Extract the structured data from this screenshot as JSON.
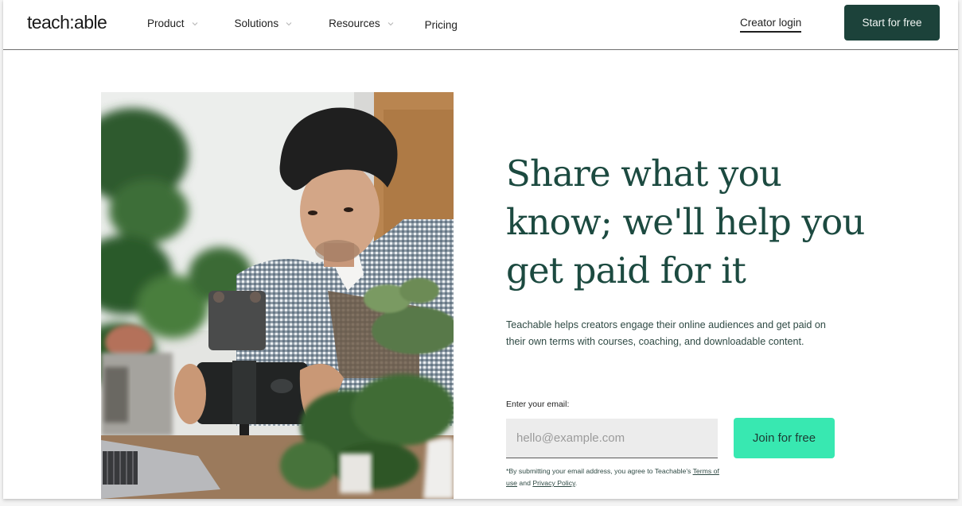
{
  "header": {
    "logo": "teach:able",
    "nav": [
      {
        "label": "Product",
        "has_dropdown": true
      },
      {
        "label": "Solutions",
        "has_dropdown": true
      },
      {
        "label": "Resources",
        "has_dropdown": true
      },
      {
        "label": "Pricing",
        "has_dropdown": false
      }
    ],
    "creator_login": "Creator login",
    "start_button": "Start for free"
  },
  "hero": {
    "photo_alt": "Man filming plants with a smartphone on a tripod",
    "headline": "Share what you know; we'll help you get paid for it",
    "subtext": "Teachable helps creators engage their online audiences and get paid on their own terms with courses, coaching, and downloadable content.",
    "email_label": "Enter your email:",
    "email_placeholder": "hello@example.com",
    "email_value": "",
    "join_button": "Join for free",
    "disclaimer": {
      "prefix": "*By submitting your email address, you agree to Teachable's ",
      "terms_link": "Terms of use",
      "middle": " and ",
      "privacy_link": "Privacy Policy",
      "suffix": "."
    }
  },
  "colors": {
    "brand_dark": "#1c423a",
    "accent_green": "#38e8b1",
    "headline": "#1c4a40"
  }
}
